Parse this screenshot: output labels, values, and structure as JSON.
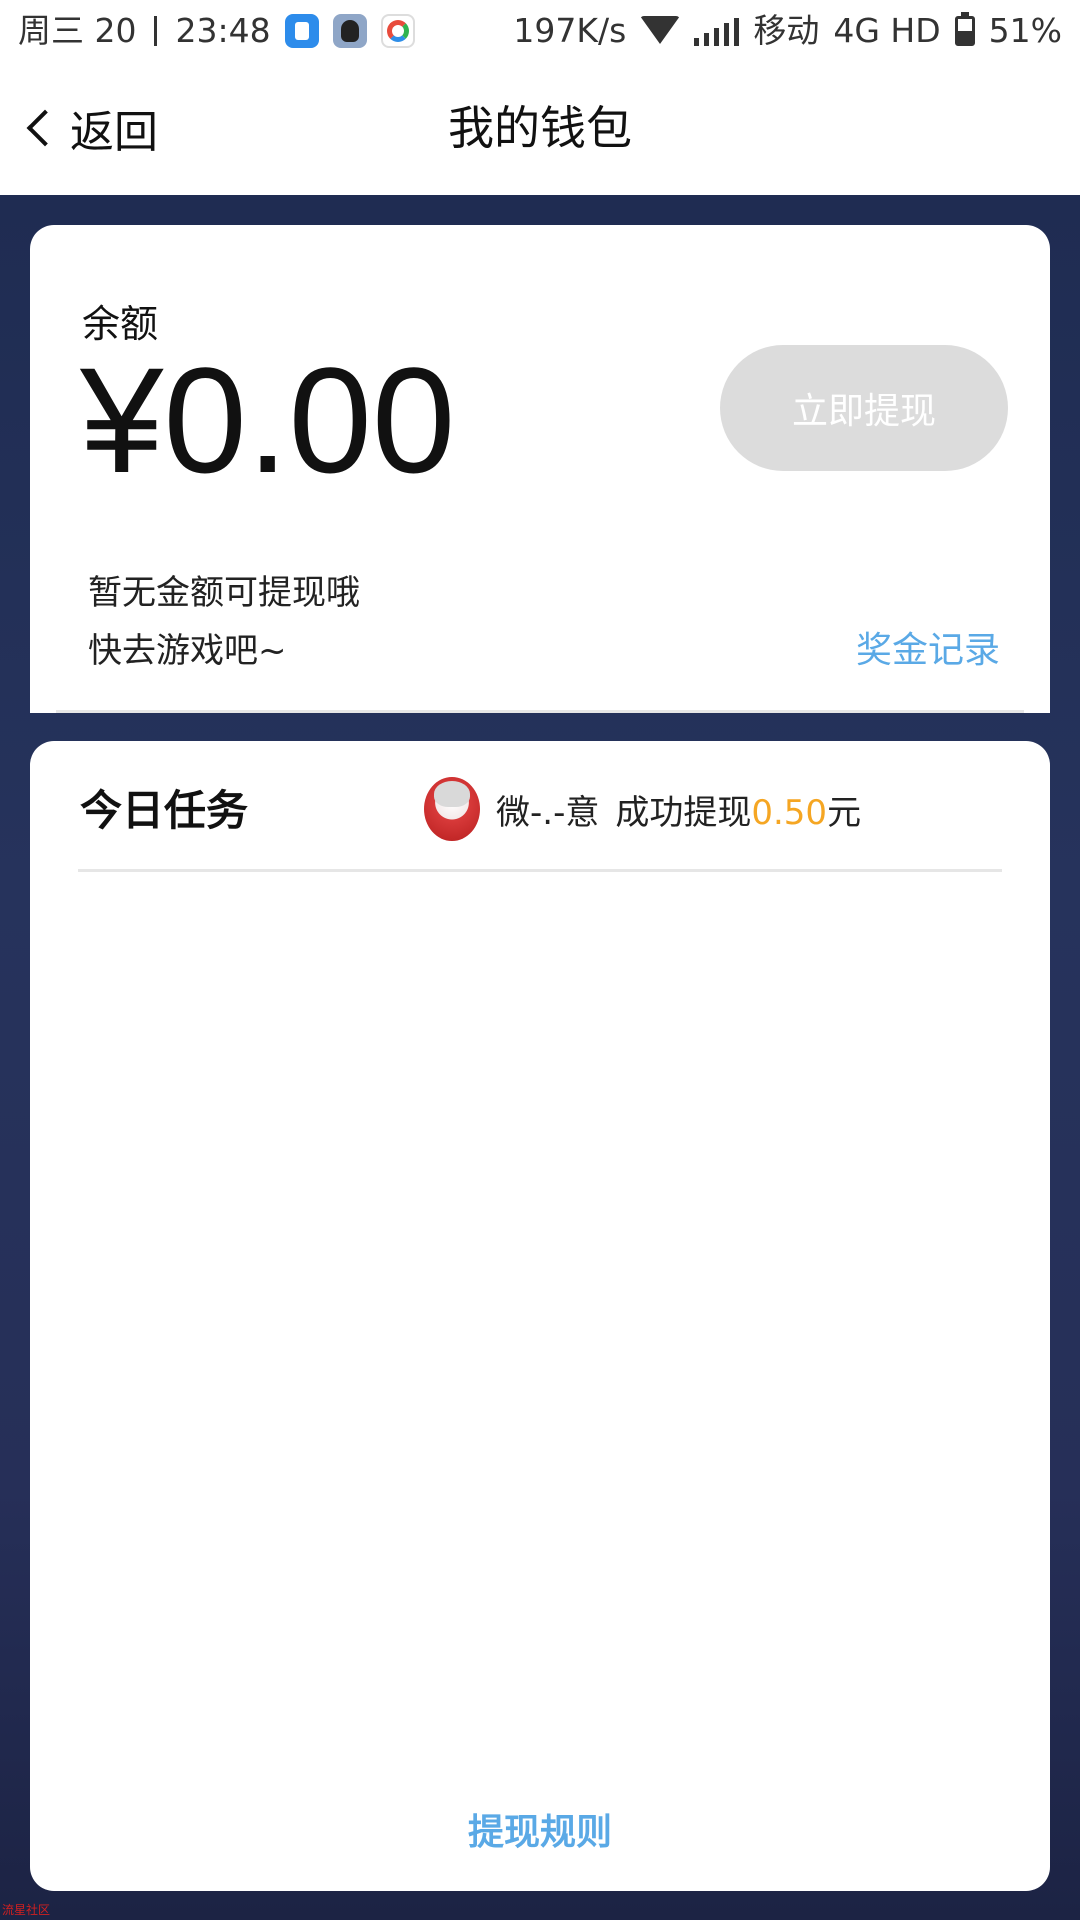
{
  "status_bar": {
    "date": "周三 20",
    "time": "23:48",
    "net_speed": "197K/s",
    "carrier": "移动",
    "network": "4G HD",
    "battery": "51%",
    "battery_level": 0.51,
    "icons": [
      "notes-app-icon",
      "qq-icon",
      "multicolor-app-icon",
      "wifi-icon",
      "signal-icon",
      "battery-icon"
    ]
  },
  "header": {
    "back_label": "返回",
    "title": "我的钱包"
  },
  "balance": {
    "label": "余额",
    "amount": "¥0.00",
    "withdraw_button": "立即提现",
    "hint_line1": "暂无金额可提现哦",
    "hint_line2": "快去游戏吧~",
    "bonus_record_link": "奖金记录"
  },
  "tasks": {
    "title": "今日任务",
    "notice_user": "微-.-意",
    "notice_action": "成功提现",
    "notice_amount": "0.50",
    "notice_unit": "元",
    "rules_link": "提现规则"
  },
  "colors": {
    "accent_blue": "#5aa9e6",
    "highlight_orange": "#f5a623",
    "background_navy": "#232d55",
    "disabled_button": "#dcdcdc"
  },
  "watermark": "流星社区"
}
